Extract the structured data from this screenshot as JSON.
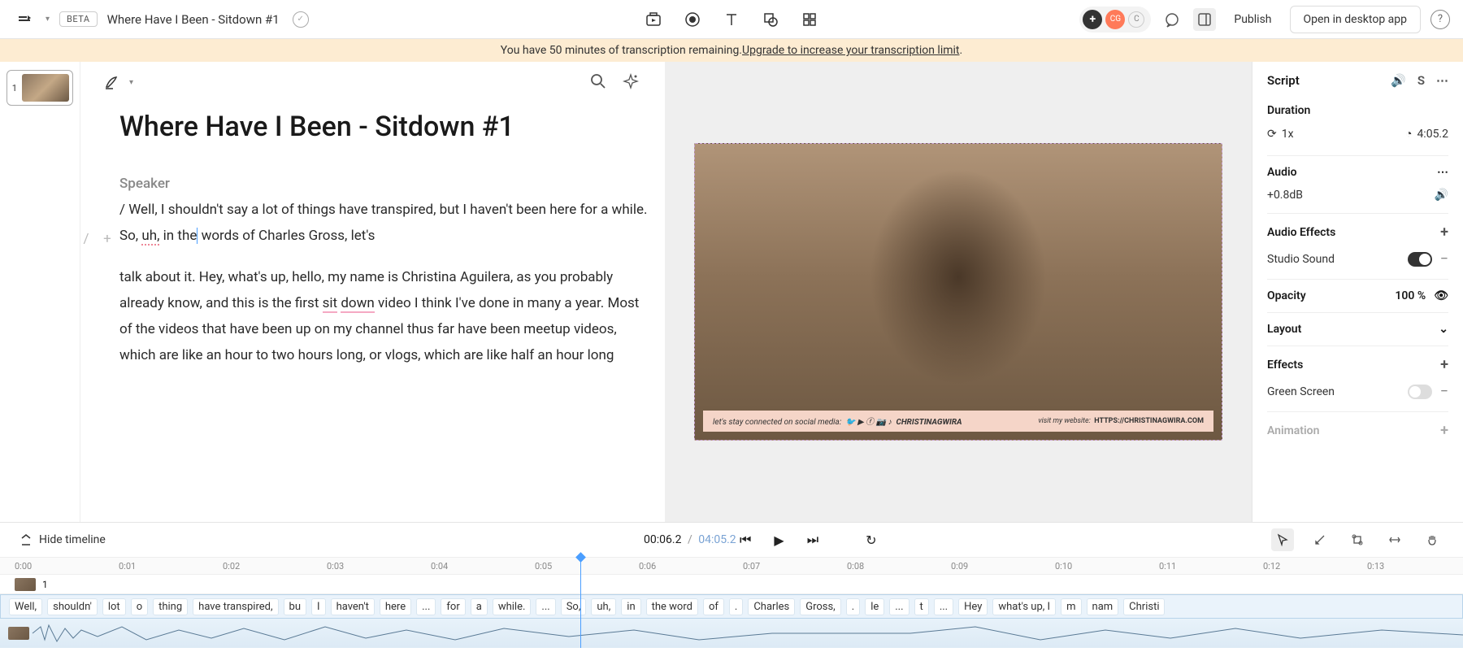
{
  "header": {
    "beta": "BETA",
    "title": "Where Have I Been - Sitdown #1",
    "publish": "Publish",
    "open_desktop": "Open in desktop app",
    "avatars": {
      "plus": "+",
      "cg": "CG",
      "c": "C"
    }
  },
  "banner": {
    "text_prefix": "You have 50 minutes of transcription remaining. ",
    "link": "Upgrade to increase your transcription limit",
    "suffix": "."
  },
  "scenes": {
    "num": "1"
  },
  "script": {
    "title": "Where Have I Been - Sitdown #1",
    "speaker": "Speaker",
    "p1_a": "/ Well, I shouldn't say a lot of things have transpired, but I haven't been here for a while. So, ",
    "p1_uh": "uh,",
    "p1_b": " in the",
    "p1_c": " words of Charles Gross, let's",
    "p2_a": "talk about it. Hey, what's up, hello, my name is Christina Aguilera, as you probably already know, and this is the first ",
    "p2_sit": "sit",
    "p2_b": " ",
    "p2_down": "down",
    "p2_c": " video I think I've done in many a year. Most of the videos that have been up on my channel thus far have been meetup videos, which are like an hour to two hours long, or vlogs, which are like half an hour long"
  },
  "preview": {
    "banner_left": "let's stay connected on social media:",
    "banner_handle": "CHRISTINAGWIRA",
    "banner_right_label": "visit my website:",
    "banner_url": "HTTPS://CHRISTINAGWIRA.COM"
  },
  "inspector": {
    "head": "Script",
    "s_letter": "S",
    "duration_lbl": "Duration",
    "speed": "1x",
    "total": "4:05.2",
    "audio_lbl": "Audio",
    "gain": "+0.8dB",
    "audio_fx_lbl": "Audio Effects",
    "studio": "Studio Sound",
    "opacity_lbl": "Opacity",
    "opacity_val": "100 %",
    "layout_lbl": "Layout",
    "effects_lbl": "Effects",
    "green": "Green Screen",
    "animation_lbl": "Animation"
  },
  "timeline": {
    "hide": "Hide timeline",
    "current": "00:06.2",
    "sep": "/",
    "total": "04:05.2",
    "ruler": [
      "0:00",
      "0:01",
      "0:02",
      "0:03",
      "0:04",
      "0:05",
      "0:06",
      "0:07",
      "0:08",
      "0:09",
      "0:10",
      "0:11",
      "0:12",
      "0:13"
    ],
    "scene_num": "1",
    "words": [
      "Well,",
      "shouldn'",
      "lot",
      "o",
      "thing",
      "have transpired,",
      "bu",
      "I",
      "haven't",
      "here",
      "...",
      "for",
      "a",
      "while.",
      "...",
      "So,",
      "uh,",
      "in",
      "the word",
      "of",
      ".",
      "Charles",
      "Gross,",
      ".",
      "le",
      "...",
      "t",
      "...",
      "Hey",
      "what's up, I",
      "m",
      "nam",
      "Christi"
    ]
  }
}
